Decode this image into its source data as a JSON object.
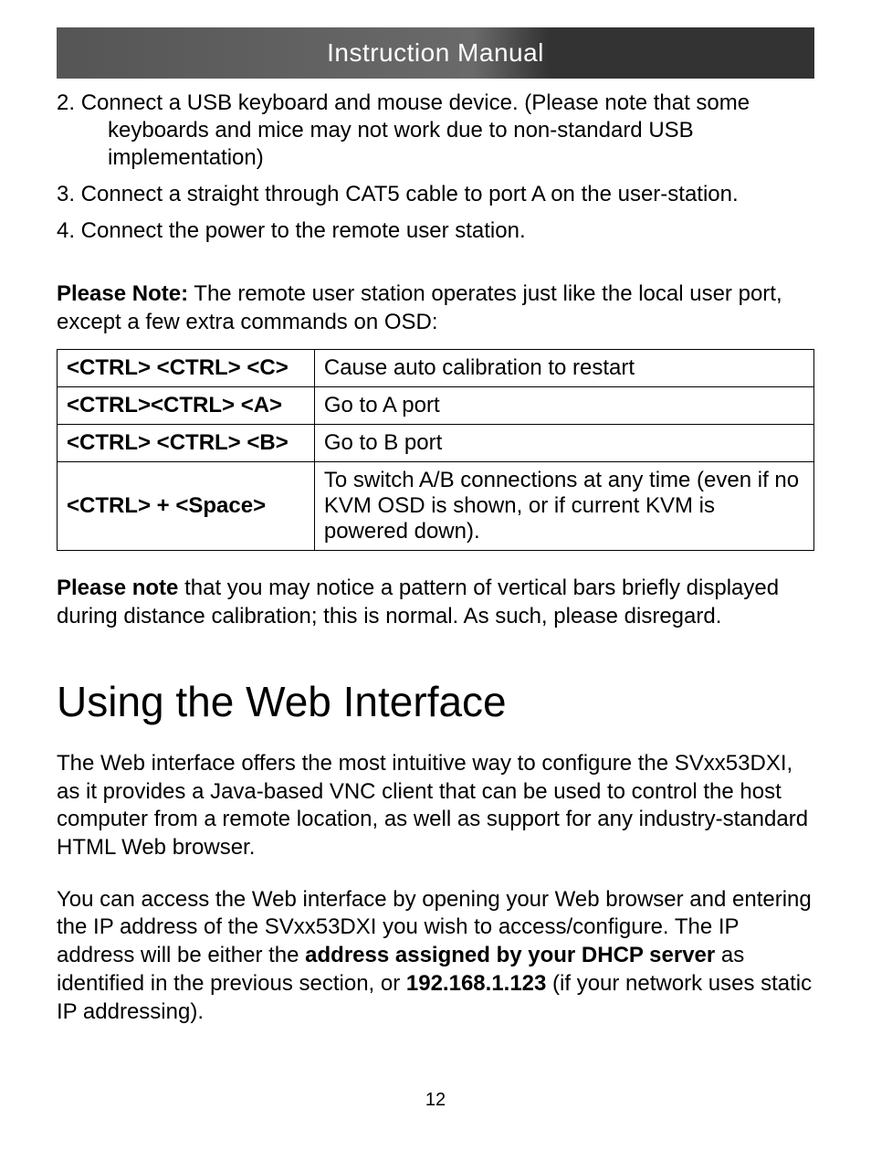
{
  "header": {
    "title": "Instruction Manual"
  },
  "steps": {
    "s2_prefix": "2. ",
    "s2_line1": "Connect a USB keyboard and mouse device. (Please note that some",
    "s2_line2": "keyboards and mice may not work due to non-standard USB",
    "s2_line3": "implementation)",
    "s3": "3. Connect a straight through CAT5 cable to port A on the user-station.",
    "s4": "4. Connect the power to the remote user station."
  },
  "note1": {
    "bold": "Please Note:",
    "rest": " The remote user station operates just like the local user port, except a few extra commands on OSD:"
  },
  "table": {
    "rows": [
      {
        "cmd": "<CTRL> <CTRL> <C>",
        "desc": "Cause auto calibration to restart"
      },
      {
        "cmd": "<CTRL><CTRL> <A>",
        "desc": "Go to A port"
      },
      {
        "cmd": "<CTRL> <CTRL> <B>",
        "desc": "Go to B port"
      },
      {
        "cmd": "<CTRL> + <Space>",
        "desc": "To switch A/B connections at any time (even if no KVM OSD is shown, or if current KVM is powered down)."
      }
    ]
  },
  "note2": {
    "bold": "Please note",
    "rest": " that you may notice a pattern of vertical bars briefly displayed during distance calibration; this is normal.  As such, please disregard."
  },
  "section": {
    "heading": "Using the Web Interface"
  },
  "para1": "The Web interface offers the most intuitive way to configure the SVxx53DXI, as it provides a Java-based VNC client that can be used to control the host computer from a remote location, as well as support for any industry-standard HTML Web browser.",
  "para2": {
    "a": "You can access the Web interface by opening your Web browser and entering the IP address of the SVxx53DXI you wish to access/configure. The IP address will be either the ",
    "bold1": "address assigned by your DHCP server",
    "b": " as identified in the previous section, or ",
    "bold2": "192.168.1.123",
    "c": " (if your network uses static IP addressing)."
  },
  "page": "12"
}
